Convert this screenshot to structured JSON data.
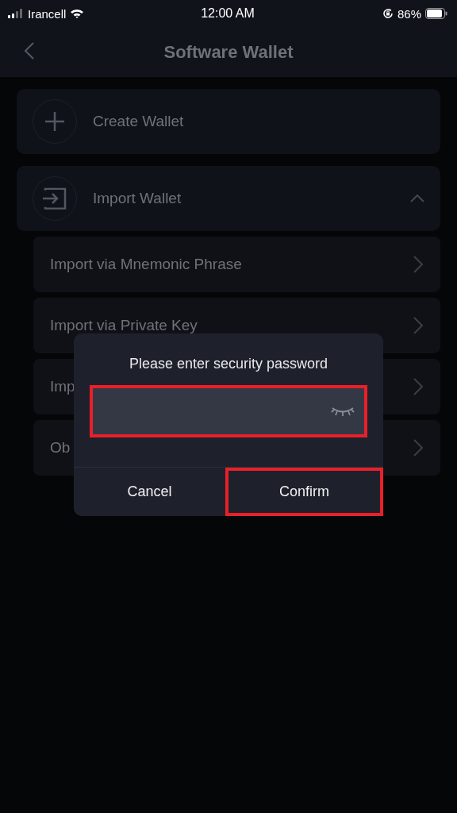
{
  "status_bar": {
    "carrier": "Irancell",
    "time": "12:00 AM",
    "battery": "86%"
  },
  "header": {
    "title": "Software Wallet"
  },
  "sections": [
    {
      "kind": "create",
      "label": "Create Wallet"
    },
    {
      "kind": "import",
      "label": "Import Wallet",
      "expanded": true,
      "children": [
        {
          "label": "Import via Mnemonic Phrase"
        },
        {
          "label": "Import via Private Key"
        },
        {
          "label": "Imp"
        },
        {
          "label": "Ob"
        }
      ]
    }
  ],
  "dialog": {
    "title": "Please enter security password",
    "field": {
      "highlighted": true
    },
    "buttons": [
      {
        "label": "Cancel",
        "highlighted": false
      },
      {
        "label": "Confirm",
        "highlighted": true
      }
    ]
  }
}
